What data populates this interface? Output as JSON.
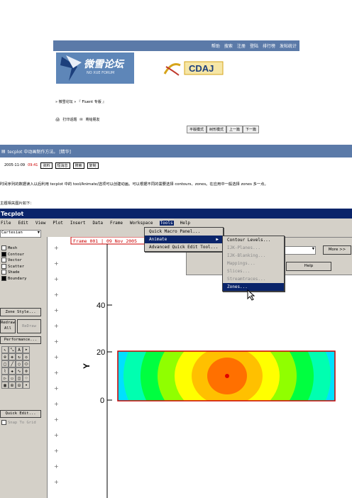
{
  "forum": {
    "top_links": [
      "帮助",
      "搜索",
      "注册",
      "登陆",
      "排行榜",
      "发帖统计"
    ],
    "logo_text": "微雪论坛",
    "logo_sub": "NO XUE FORUM",
    "partner_logo": "CDAJ",
    "breadcrumb": "» 微雪论坛 » 『 Fluent 专版 』",
    "print_label": "打印话题",
    "send_label": "寄给朋友",
    "post_nav": [
      "平版模式",
      "树形模式",
      "上一篇",
      "下一篇"
    ],
    "thread_title": "tecplot 中动画制作方法。 [精华]",
    "post_date": "2005-11-09",
    "post_time": "09:41",
    "post_buttons": [
      "资料",
      "短消息",
      "搜索",
      "复制"
    ],
    "body_line1": "时间序列的数据读入以后利用 tecplot 中的 tool/Animate/选项可以创建动画。可以根据不同的需要选择 contours、zones。在应用中一般选择 zones 多一点。",
    "body_line2": "主题相关图片如下："
  },
  "tecplot": {
    "title": "Tecplot",
    "menu": [
      "File",
      "Edit",
      "View",
      "Plot",
      "Insert",
      "Data",
      "Frame",
      "Workspace",
      "Tools",
      "Help"
    ],
    "active_menu": "Tools",
    "tools_menu": [
      "Quick Macro Panel...",
      "Animate",
      "Advanced Quick Edit Tool..."
    ],
    "animate_submenu": [
      "Contour Levels...",
      "IJK-Planes...",
      "IJK-Blanking...",
      "Mappings...",
      "Slices...",
      "Streamtraces...",
      "Zones..."
    ],
    "animate_disabled": [
      false,
      true,
      true,
      true,
      true,
      true,
      false
    ],
    "animate_selected": "Zones...",
    "frame_label": "Frame 001 | 09 Nov 2005",
    "more_button": "More >>",
    "help_button": "Help",
    "plot_type": "Cartesian",
    "layers": [
      "Mesh",
      "Contour",
      "Vector",
      "Scatter",
      "Shade",
      "Boundary"
    ],
    "layers_checked": [
      false,
      true,
      false,
      false,
      false,
      true
    ],
    "zone_style": "Zone Style...",
    "redraw": "Redraw",
    "redraw_all": "All",
    "redraw_btn2": "ReDraw",
    "performance": "Performance...",
    "quick_edit": "Quick Edit...",
    "snap": "Snap To Grid",
    "y_axis_label": "Y",
    "y_ticks": [
      "40",
      "20",
      "0"
    ]
  },
  "colors": {
    "forum_blue": "#5b7aa8",
    "win_title": "#0a246a",
    "win_face": "#d4d0c8",
    "frame_red": "#cc0000"
  }
}
